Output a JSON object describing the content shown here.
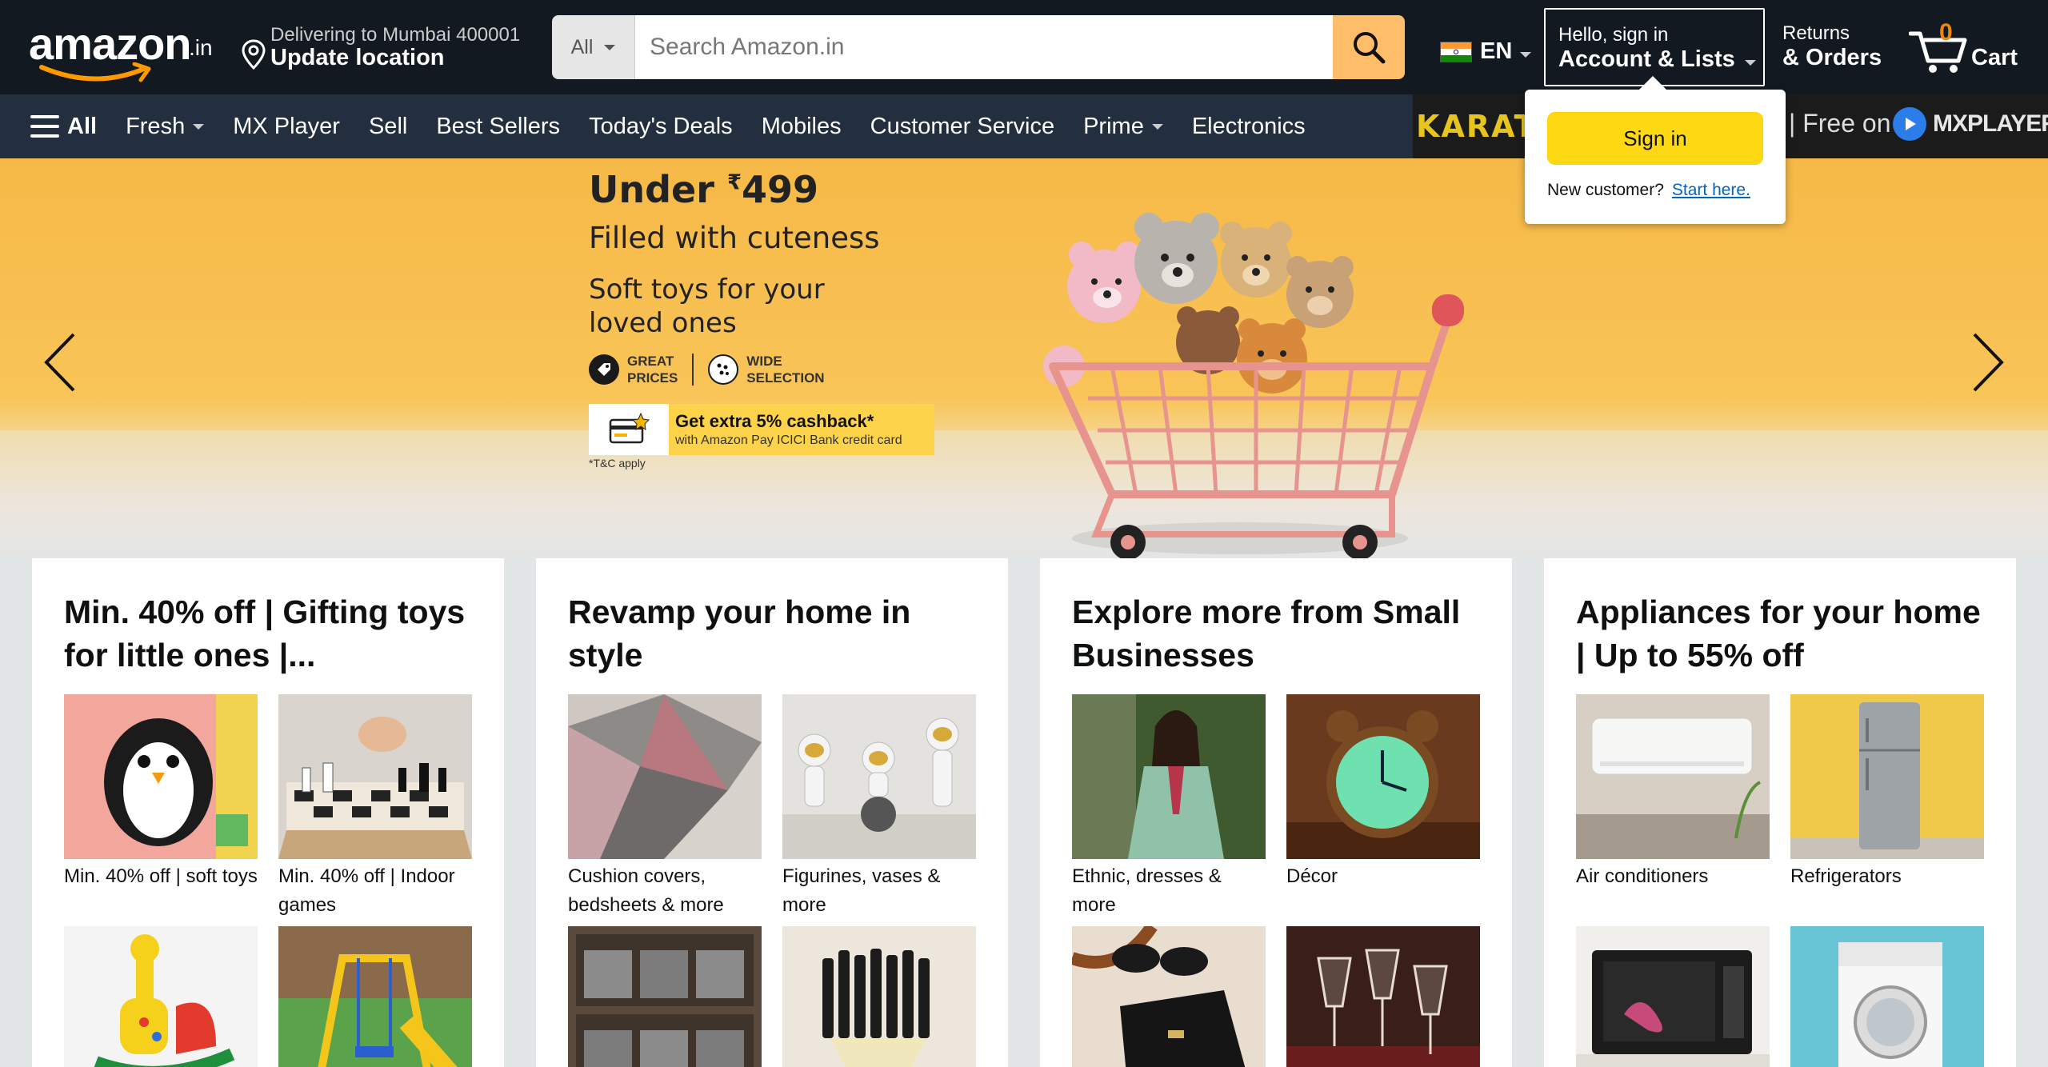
{
  "header": {
    "logo_text": "amazon",
    "logo_suffix": ".in",
    "deliver_line1": "Delivering to Mumbai 400001",
    "deliver_line2": "Update location",
    "search_category": "All",
    "search_placeholder": "Search Amazon.in",
    "language": "EN",
    "account_line1": "Hello, sign in",
    "account_line2": "Account & Lists",
    "returns_line1": "Returns",
    "returns_line2": "& Orders",
    "cart_count": "0",
    "cart_label": "Cart"
  },
  "nav": {
    "all": "All",
    "items": [
      "Fresh",
      "MX Player",
      "Sell",
      "Best Sellers",
      "Today's Deals",
      "Mobiles",
      "Customer Service",
      "Prime",
      "Electronics"
    ],
    "promo_left": "KARATE",
    "promo_free": "| Free on",
    "promo_brand": "MXPLAYER"
  },
  "hero": {
    "under_prefix": "Under ",
    "under_currency": "₹",
    "under_value": "499",
    "filled": "Filled with cuteness",
    "soft": "Soft toys for your loved ones",
    "badge1": [
      "GREAT",
      "PRICES"
    ],
    "badge2": [
      "WIDE",
      "SELECTION"
    ],
    "cashback_title": "Get extra 5% cashback*",
    "cashback_sub": "with Amazon Pay ICICI Bank credit card",
    "tnc": "*T&C apply"
  },
  "flyout": {
    "signin_label": "Sign in",
    "new_customer": "New customer?",
    "start_here": "Start here."
  },
  "cards": [
    {
      "title": "Min. 40% off | Gifting toys for little ones |...",
      "tiles": [
        {
          "caption": "Min. 40% off | soft toys",
          "icon": "penguin-toy"
        },
        {
          "caption": "Min. 40% off | Indoor games",
          "icon": "chess-board"
        },
        {
          "caption": "",
          "icon": "rocking-giraffe"
        },
        {
          "caption": "",
          "icon": "swing-slide"
        }
      ]
    },
    {
      "title": "Revamp your home in style",
      "tiles": [
        {
          "caption": "Cushion covers, bedsheets & more",
          "icon": "rug"
        },
        {
          "caption": "Figurines, vases & more",
          "icon": "astronaut-figurines"
        },
        {
          "caption": "",
          "icon": "storage-boxes"
        },
        {
          "caption": "",
          "icon": "wall-lamp"
        }
      ]
    },
    {
      "title": "Explore more from Small Businesses",
      "tiles": [
        {
          "caption": "Ethnic, dresses & more",
          "icon": "ethnic-dress"
        },
        {
          "caption": "Décor",
          "icon": "alarm-clock"
        },
        {
          "caption": "",
          "icon": "handbag-sunglasses"
        },
        {
          "caption": "",
          "icon": "wine-glasses"
        }
      ]
    },
    {
      "title": "Appliances for your home | Up to 55% off",
      "tiles": [
        {
          "caption": "Air conditioners",
          "icon": "air-conditioner"
        },
        {
          "caption": "Refrigerators",
          "icon": "refrigerator"
        },
        {
          "caption": "",
          "icon": "microwave"
        },
        {
          "caption": "",
          "icon": "washing-machine"
        }
      ]
    }
  ],
  "colors": {
    "nav_top": "#131921",
    "nav_bottom": "#232f3e",
    "search_button": "#febd69",
    "signin_button": "#ffd814",
    "link": "#0066c0",
    "cart_count": "#f08804"
  }
}
